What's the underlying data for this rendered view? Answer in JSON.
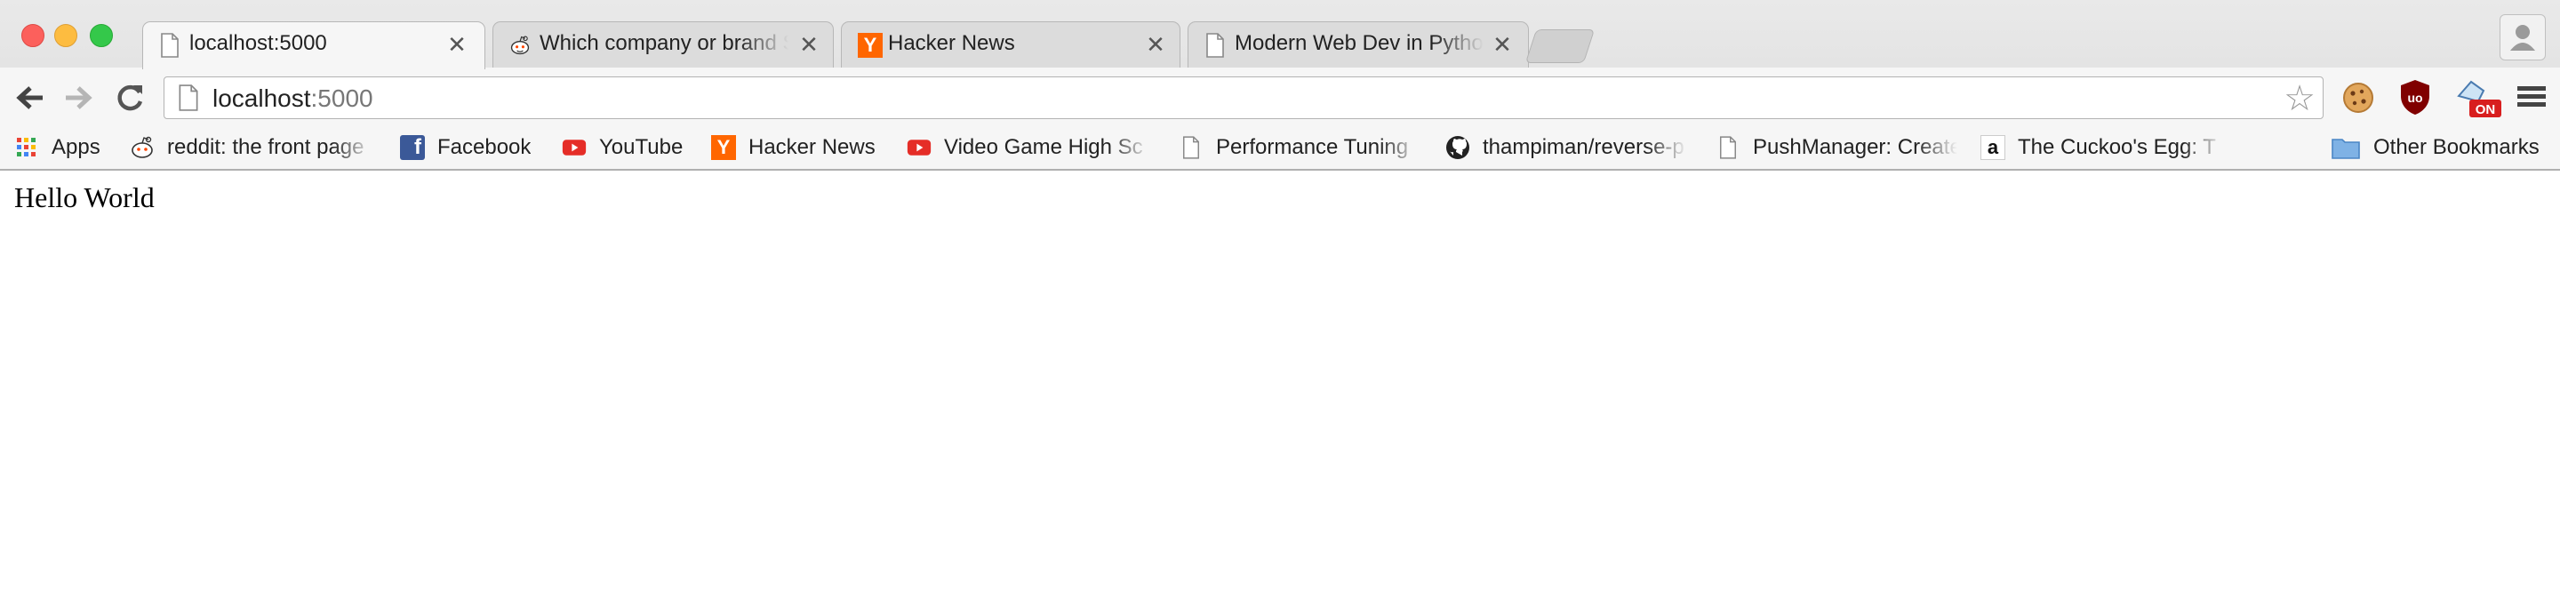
{
  "tabs": [
    {
      "title": "localhost:5000",
      "icon": "page-icon",
      "active": true
    },
    {
      "title": "Which company or brand S",
      "icon": "reddit-icon",
      "active": false
    },
    {
      "title": "Hacker News",
      "icon": "hacker-news-icon",
      "active": false
    },
    {
      "title": "Modern Web Dev in Python",
      "icon": "page-icon",
      "active": false
    }
  ],
  "tab_close_glyph": "✕",
  "omnibox": {
    "host": "localhost",
    "port": ":5000"
  },
  "bookmarks": [
    {
      "label": "Apps",
      "icon": "apps-grid-icon"
    },
    {
      "label": "reddit: the front page",
      "icon": "reddit-icon"
    },
    {
      "label": "Facebook",
      "icon": "facebook-icon"
    },
    {
      "label": "YouTube",
      "icon": "youtube-icon"
    },
    {
      "label": "Hacker News",
      "icon": "hacker-news-icon"
    },
    {
      "label": "Video Game High Sc",
      "icon": "youtube-icon"
    },
    {
      "label": "Performance Tuning",
      "icon": "page-icon"
    },
    {
      "label": "thampiman/reverse-p",
      "icon": "github-icon"
    },
    {
      "label": "PushManager: Create",
      "icon": "page-icon"
    },
    {
      "label": "The Cuckoo's Egg: T",
      "icon": "amazon-icon"
    },
    {
      "label": "Other Bookmarks",
      "icon": "folder-icon"
    }
  ],
  "extensions": [
    {
      "name": "cookie-icon"
    },
    {
      "name": "ublock-icon",
      "badge": "uo"
    },
    {
      "name": "toggle-on-extension-icon",
      "badge": "ON"
    },
    {
      "name": "menu-icon"
    }
  ],
  "page": {
    "text": "Hello World"
  },
  "colors": {
    "hn_orange": "#ff6600",
    "youtube_red": "#e52d27",
    "facebook_blue": "#3b5998"
  }
}
